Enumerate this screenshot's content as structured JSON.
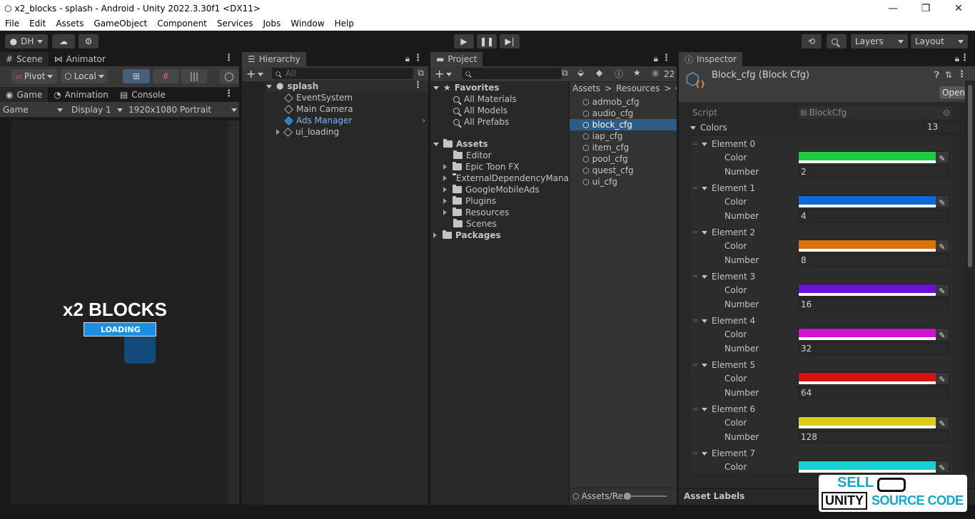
{
  "window": {
    "title": "x2_blocks - splash - Android - Unity 2022.3.30f1 <DX11>",
    "minimize": "—",
    "maximize": "❐",
    "close": "✕"
  },
  "menu": [
    "File",
    "Edit",
    "Assets",
    "GameObject",
    "Component",
    "Services",
    "Jobs",
    "Window",
    "Help"
  ],
  "toolbar": {
    "account": "DH",
    "layers": "Layers",
    "layout": "Layout"
  },
  "scene_tabs": [
    "Scene",
    "Animator"
  ],
  "scene_tools": {
    "pivot": "Pivot",
    "local": "Local"
  },
  "game_tabs": [
    "Game",
    "Animation",
    "Console"
  ],
  "game_bar": {
    "mode": "Game",
    "display": "Display 1",
    "resolution": "1920x1080 Portrait"
  },
  "game_view": {
    "title": "x2 BLOCKS",
    "loading": "LOADING"
  },
  "hierarchy": {
    "tab": "Hierarchy",
    "search_placeholder": "All",
    "scene": "splash",
    "items": [
      "EventSystem",
      "Main Camera",
      "Ads Manager",
      "ui_loading"
    ]
  },
  "project": {
    "tab": "Project",
    "count": "22",
    "favorites": {
      "label": "Favorites",
      "items": [
        "All Materials",
        "All Models",
        "All Prefabs"
      ]
    },
    "assets": {
      "label": "Assets",
      "items": [
        "Editor",
        "Epic Toon FX",
        "ExternalDependencyMana",
        "GoogleMobileAds",
        "Plugins",
        "Resources",
        "Scenes"
      ]
    },
    "packages": "Packages",
    "breadcrumb": [
      "Assets",
      "Resources",
      "Ga"
    ],
    "files": [
      "admob_cfg",
      "audio_cfg",
      "block_cfg",
      "iap_cfg",
      "item_cfg",
      "pool_cfg",
      "quest_cfg",
      "ui_cfg"
    ],
    "selected_file": "block_cfg",
    "footer_path": "Assets/Re:"
  },
  "inspector": {
    "tab": "Inspector",
    "object_title": "Block_cfg (Block Cfg)",
    "open_button": "Open",
    "script_label": "Script",
    "script_value": "BlockCfg",
    "colors_label": "Colors",
    "colors_count": "13",
    "color_label": "Color",
    "number_label": "Number",
    "elements": [
      {
        "name": "Element 0",
        "color": "#1ecb3e",
        "number": "2"
      },
      {
        "name": "Element 1",
        "color": "#1269d4",
        "number": "4"
      },
      {
        "name": "Element 2",
        "color": "#d8740f",
        "number": "8"
      },
      {
        "name": "Element 3",
        "color": "#6a12d6",
        "number": "16"
      },
      {
        "name": "Element 4",
        "color": "#cf14cf",
        "number": "32"
      },
      {
        "name": "Element 5",
        "color": "#d8120f",
        "number": "64"
      },
      {
        "name": "Element 6",
        "color": "#d6d01a",
        "number": "128"
      },
      {
        "name": "Element 7",
        "color": "#17cfd4",
        "number": ""
      }
    ],
    "asset_labels": "Asset Labels"
  },
  "watermark": {
    "line1": "SELL",
    "line2": "UNITY",
    "line3": "SOURCE CODE"
  },
  "colors": {
    "selection": "#2c5d87",
    "accent_blue": "#1a8fe0",
    "link": "#7cb4f4"
  }
}
